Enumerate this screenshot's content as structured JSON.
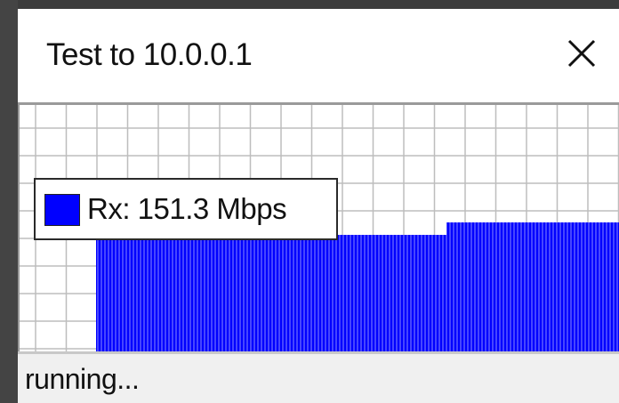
{
  "window": {
    "title": "Test to 10.0.0.1"
  },
  "graph": {
    "series_color": "#0000ff",
    "legend_label": "Rx: 151.3 Mbps"
  },
  "status": {
    "text": "running..."
  },
  "icons": {
    "close": "close-icon"
  }
}
